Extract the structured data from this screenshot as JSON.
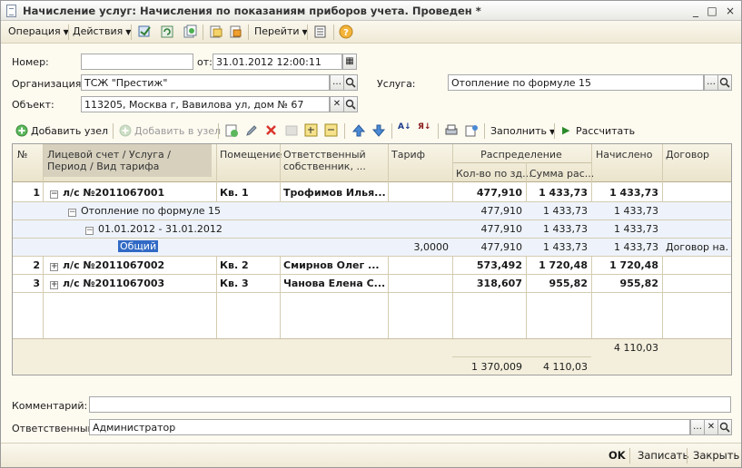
{
  "window": {
    "title": "Начисление услуг: Начисления по показаниям приборов учета. Проведен *",
    "controls": [
      "_",
      "□",
      "×"
    ]
  },
  "toolbar": {
    "operation": "Операция",
    "actions": "Действия",
    "goto": "Перейти",
    "help": "?"
  },
  "form": {
    "number_label": "Номер:",
    "number_value": "",
    "date_label": "от:",
    "date_value": "31.01.2012 12:00:11",
    "org_label": "Организация:",
    "org_value": "ТСЖ \"Престиж\"",
    "service_label": "Услуга:",
    "service_value": "Отопление по формуле 15",
    "object_label": "Объект:",
    "object_value": "113205, Москва г, Вавилова ул, дом № 67",
    "comment_label": "Комментарий:",
    "comment_value": "",
    "responsible_label": "Ответственный:",
    "responsible_value": "Администратор"
  },
  "grid_toolbar": {
    "add_node": "Добавить узел",
    "add_into_node": "Добавить в узел",
    "fill": "Заполнить",
    "calculate": "Рассчитать"
  },
  "grid": {
    "headers": {
      "num": "№",
      "account": "Лицевой счет / Услуга / Период / Вид тарифа",
      "premises": "Помещение",
      "owner": "Ответственный собственник, ...",
      "tariff": "Тариф",
      "distribution": "Распределение",
      "qty": "Кол-во по зд...",
      "sum": "Сумма рас...",
      "charged": "Начислено",
      "contract": "Договор"
    },
    "rows": [
      {
        "num": "1",
        "tree": "⊖",
        "account": "л/с №2011067001",
        "premises": "Кв. 1",
        "owner": "Трофимов Илья...",
        "tariff": "",
        "qty": "477,910",
        "sum": "1 433,73",
        "charged": "1 433,73",
        "contract": "",
        "bold": true
      },
      {
        "num": "",
        "tree": "⊖",
        "account": "Отопление по формуле 15",
        "premises": "",
        "owner": "",
        "tariff": "",
        "qty": "477,910",
        "sum": "1 433,73",
        "charged": "1 433,73",
        "contract": "",
        "bold": false
      },
      {
        "num": "",
        "tree": "⊖",
        "account": "01.01.2012 - 31.01.2012",
        "premises": "",
        "owner": "",
        "tariff": "",
        "qty": "477,910",
        "sum": "1 433,73",
        "charged": "1 433,73",
        "contract": "",
        "bold": false
      },
      {
        "num": "",
        "tree": "",
        "account": "Общий",
        "premises": "",
        "owner": "",
        "tariff": "3,0000",
        "qty": "477,910",
        "sum": "1 433,73",
        "charged": "1 433,73",
        "contract": "Договор на...",
        "bold": false
      },
      {
        "num": "2",
        "tree": "⊕",
        "account": "л/с №2011067002",
        "premises": "Кв. 2",
        "owner": "Смирнов Олег ...",
        "tariff": "",
        "qty": "573,492",
        "sum": "1 720,48",
        "charged": "1 720,48",
        "contract": "",
        "bold": true
      },
      {
        "num": "3",
        "tree": "⊕",
        "account": "л/с №2011067003",
        "premises": "Кв. 3",
        "owner": "Чанова Елена С...",
        "tariff": "",
        "qty": "318,607",
        "sum": "955,82",
        "charged": "955,82",
        "contract": "",
        "bold": true
      }
    ],
    "totals": {
      "charged": "4 110,03",
      "qty": "1 370,009",
      "sum": "4 110,03"
    }
  },
  "bottom": {
    "ok": "OK",
    "save": "Записать",
    "close": "Закрыть"
  },
  "colors": {
    "background": "#fdfaf0",
    "selection": "#316ac5",
    "row_highlight": "#eef3fb",
    "header": "#ebe4cc"
  }
}
